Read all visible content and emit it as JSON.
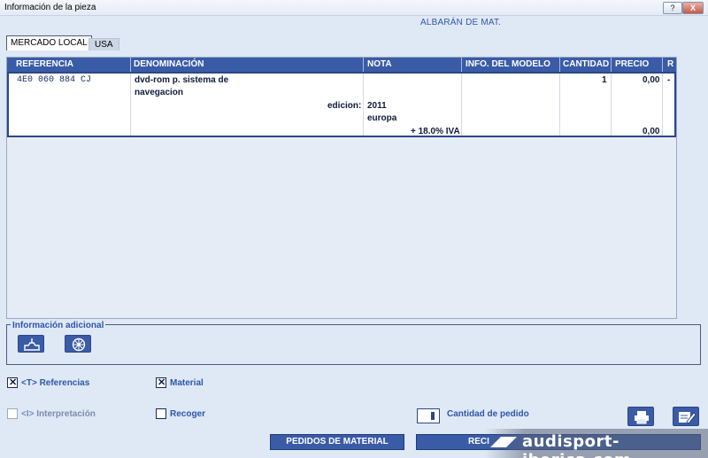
{
  "window": {
    "title": "Información de la pieza",
    "help_label": "?",
    "close_label": "X"
  },
  "document_title": "ALBARÁN DE MAT.",
  "tabs": [
    {
      "label": "MERCADO LOCAL"
    },
    {
      "label": "USA"
    }
  ],
  "table": {
    "headers": [
      "REFERENCIA",
      "DENOMINACIÓN",
      "NOTA",
      "INFO. DEL MODELO",
      "CANTIDAD",
      "PRECIO",
      "R"
    ],
    "row": {
      "referencia": "4E0 060 884 CJ",
      "denominacion_line1": "dvd-rom p. sistema de",
      "denominacion_line2": "navegacion",
      "edicion_label": "edicion:",
      "nota_line1": "2011",
      "nota_line2": "europa",
      "iva": "+ 18.0% IVA",
      "cantidad": "1",
      "precio": "0,00",
      "precio_total": "0,00",
      "r": "-"
    }
  },
  "info_adicional": {
    "label": "Información adicional",
    "icons": [
      "car-lift-icon",
      "wheel-icon"
    ]
  },
  "options": {
    "referencias": {
      "label": "<T> Referencias",
      "checked": true
    },
    "material": {
      "label": "Material",
      "checked": true
    },
    "interpretacion": {
      "label": "<I> Interpretación",
      "checked": false,
      "disabled": true
    },
    "recoger": {
      "label": "Recoger",
      "checked": false
    }
  },
  "cantidad_pedido": {
    "label": "Cantidad de pedido",
    "value": ""
  },
  "tools": [
    "print-icon",
    "edit-note-icon"
  ],
  "actions": {
    "pedidos": "PEDIDOS DE MATERIAL",
    "second": "RECI"
  },
  "watermark": "audisport-iberica.com",
  "colors": {
    "header": "#3a5ba6",
    "accent_text": "#2f56a8",
    "background": "#dfe8f5"
  }
}
